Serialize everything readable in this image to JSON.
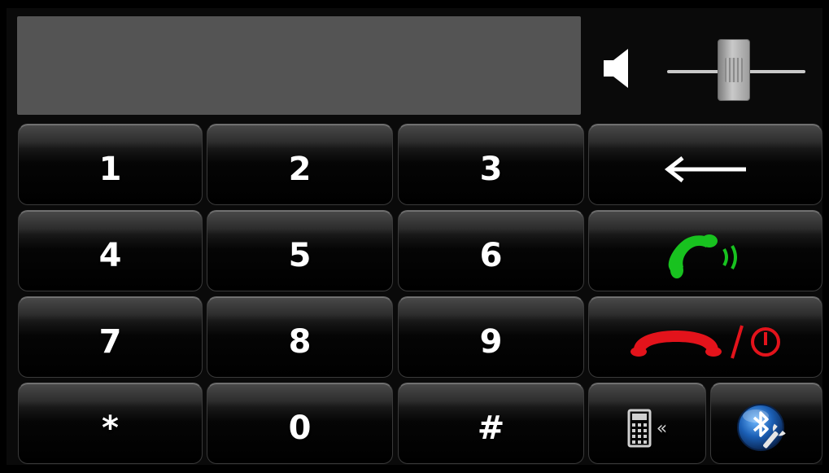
{
  "display": {
    "value": ""
  },
  "volume": {
    "level": 0.48
  },
  "keypad": {
    "k1": "1",
    "k2": "2",
    "k3": "3",
    "k4": "4",
    "k5": "5",
    "k6": "6",
    "k7": "7",
    "k8": "8",
    "k9": "9",
    "kstar": "*",
    "k0": "0",
    "khash": "#"
  },
  "icons": {
    "speaker": "speaker-icon",
    "backspace": "backspace-arrow-icon",
    "call": "call-answer-icon",
    "hangup": "hang-up-icon",
    "power": "power-icon",
    "phonebook": "keypad-phone-icon",
    "bluetooth": "bluetooth-settings-icon"
  },
  "colors": {
    "call_green": "#18c21f",
    "hangup_red": "#e3131b",
    "display_bg": "#545454",
    "key_text": "#ffffff"
  },
  "labels": {
    "collapse_chevron": "«"
  }
}
